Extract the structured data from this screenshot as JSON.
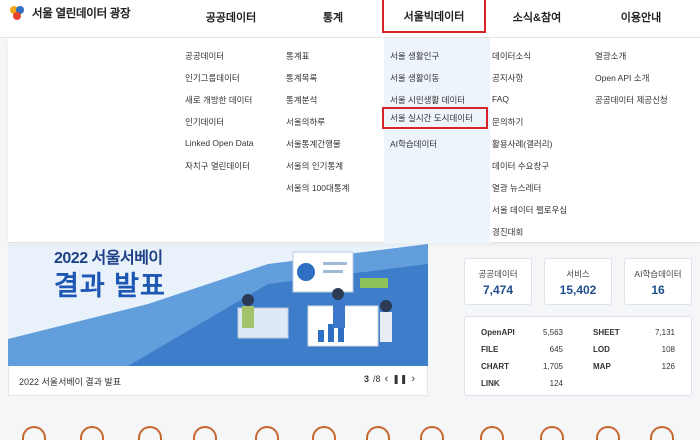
{
  "site": {
    "title": "서울 열린데이터 광장"
  },
  "gnb": [
    {
      "label": "공공데이터",
      "active": false
    },
    {
      "label": "통계",
      "active": false
    },
    {
      "label": "서울빅데이터",
      "active": true
    },
    {
      "label": "소식&참여",
      "active": false
    },
    {
      "label": "이용안내",
      "active": false
    }
  ],
  "menu": {
    "col1": [
      "공공데이터",
      "인기그룹데이터",
      "새로 개방한 데이터",
      "인기데이터",
      "Linked Open Data",
      "자치구 열린데이터"
    ],
    "col2": [
      "통계표",
      "통계목록",
      "통계분석",
      "서울의하루",
      "서울통계간행물",
      "서울의 인기통계",
      "서울의 100대통계"
    ],
    "col3": [
      "서울 생활인구",
      "서울 생활이동",
      "서울 시민생활 데이터",
      "서울 실시간 도시데이터",
      "AI학습데이터"
    ],
    "col4": [
      "데이터소식",
      "공지사항",
      "FAQ",
      "문의하기",
      "활용사례(갤러리)",
      "데이터 수요창구",
      "열광 뉴스레터",
      "서울 데이터 펠로우십",
      "경진대회"
    ],
    "col5": [
      "열광소개",
      "Open API 소개",
      "공공데이터 제공신청"
    ]
  },
  "banner": {
    "line1": "2022 서울서베이",
    "line2": "결과 발표",
    "caption": "2022 서울서베이 결과 발표",
    "page_current": "3",
    "page_total": "/8"
  },
  "stats": [
    {
      "label": "공공데이터",
      "value": "7,474"
    },
    {
      "label": "서비스",
      "value": "15,402"
    },
    {
      "label": "AI학습데이터",
      "value": "16"
    }
  ],
  "counts": [
    {
      "key": "OpenAPI",
      "value": "5,563"
    },
    {
      "key": "SHEET",
      "value": "7,131"
    },
    {
      "key": "FILE",
      "value": "645"
    },
    {
      "key": "LOD",
      "value": "108"
    },
    {
      "key": "CHART",
      "value": "1,705"
    },
    {
      "key": "MAP",
      "value": "126"
    },
    {
      "key": "LINK",
      "value": "124"
    }
  ],
  "colors": {
    "accent_red": "#d8232a",
    "brand_blue": "#1f4e8c",
    "banner_bg": "#e9f2fb"
  }
}
